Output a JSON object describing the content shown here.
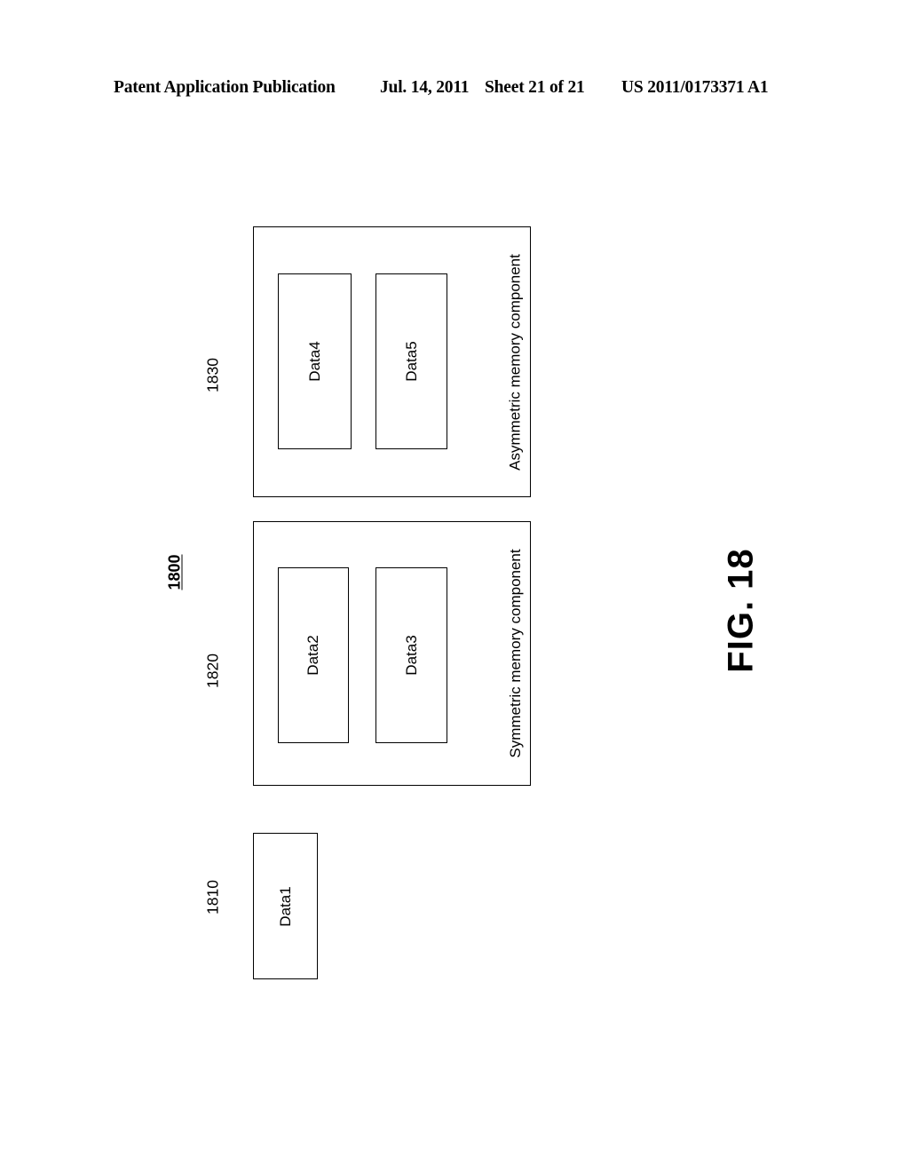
{
  "header": {
    "publication": "Patent Application Publication",
    "date": "Jul. 14, 2011",
    "sheet": "Sheet 21 of 21",
    "patent_number": "US 2011/0173371 A1"
  },
  "figure": {
    "label": "FIG. 18",
    "overall_ref": "1800",
    "blocks": [
      {
        "ref": "1830",
        "caption": "Asymmetric memory component",
        "cells": [
          {
            "label": "Data4"
          },
          {
            "label": "Data5"
          }
        ]
      },
      {
        "ref": "1820",
        "caption": "Symmetric memory component",
        "cells": [
          {
            "label": "Data2"
          },
          {
            "label": "Data3"
          }
        ]
      },
      {
        "ref": "1810",
        "caption": "",
        "cells": [
          {
            "label": "Data1"
          }
        ]
      }
    ]
  }
}
